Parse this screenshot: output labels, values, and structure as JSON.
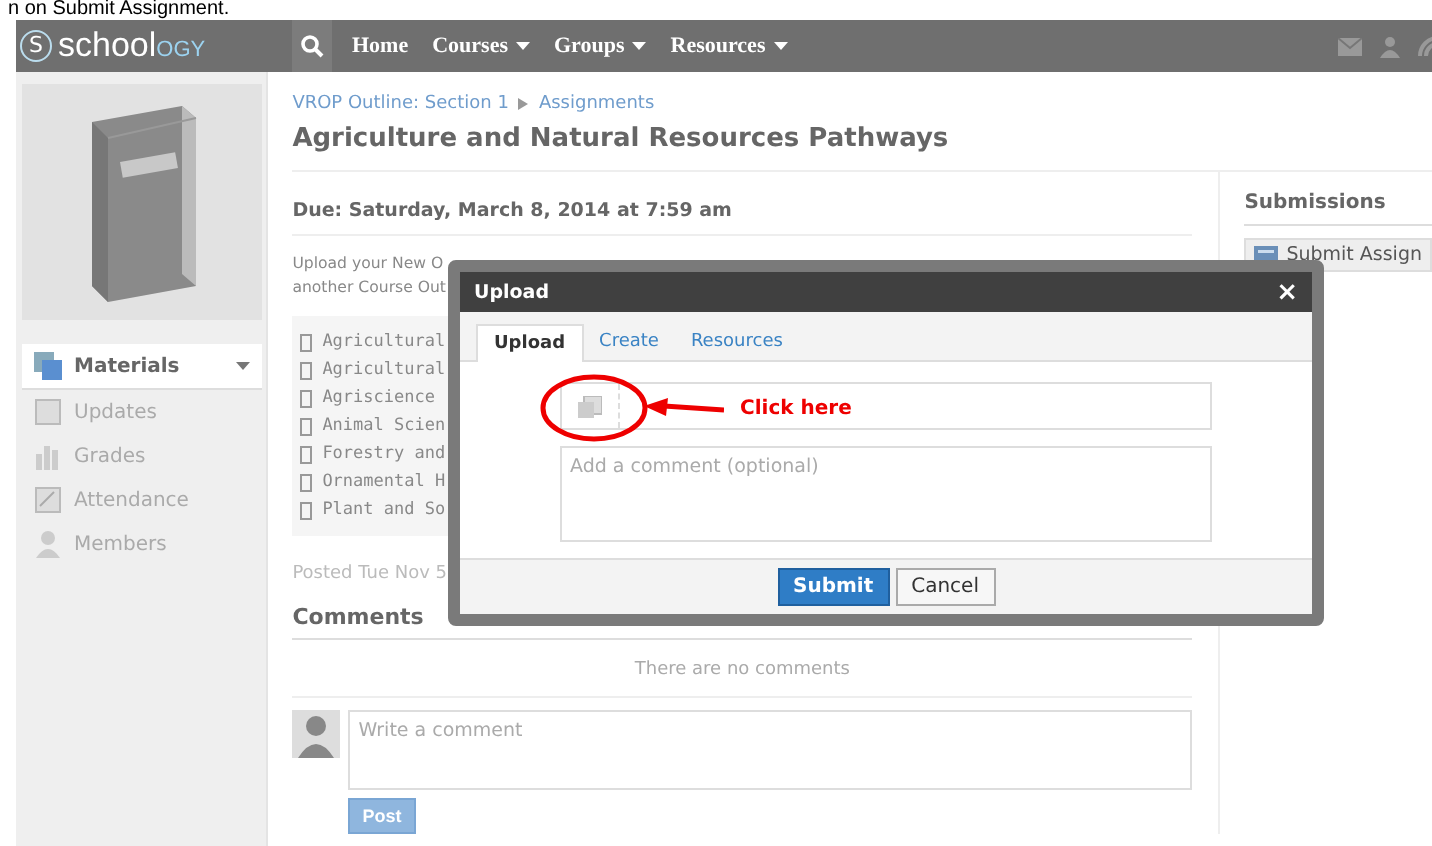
{
  "caption": "n on Submit Assignment.",
  "header": {
    "logo_mark": "S",
    "logo": [
      "school",
      "OGY"
    ],
    "nav": [
      {
        "label": "Home",
        "dropdown": false
      },
      {
        "label": "Courses",
        "dropdown": true
      },
      {
        "label": "Groups",
        "dropdown": true
      },
      {
        "label": "Resources",
        "dropdown": true
      }
    ]
  },
  "sidebar": {
    "items": [
      {
        "label": "Materials",
        "selected": true
      },
      {
        "label": "Updates",
        "selected": false
      },
      {
        "label": "Grades",
        "selected": false
      },
      {
        "label": "Attendance",
        "selected": false
      },
      {
        "label": "Members",
        "selected": false
      }
    ]
  },
  "breadcrumb": [
    "VROP Outline: Section 1",
    "Assignments"
  ],
  "title": "Agriculture and Natural Resources Pathways",
  "due": "Due: Saturday, March 8, 2014 at 7:59 am",
  "description_lines": [
    "Upload your New O",
    "another Course Out"
  ],
  "list_items": [
    "Agricultural",
    "Agricultural",
    "Agriscience",
    "Animal Scien",
    "Forestry and",
    "Ornamental H",
    "Plant and So"
  ],
  "posted": "Posted Tue Nov 5",
  "comments": {
    "heading": "Comments",
    "empty": "There are no comments",
    "placeholder": "Write a comment",
    "post_button": "Post"
  },
  "submissions": {
    "heading": "Submissions",
    "button": "Submit Assign"
  },
  "dialog": {
    "title": "Upload",
    "close": "×",
    "tabs": [
      {
        "label": "Upload",
        "selected": true
      },
      {
        "label": "Create",
        "selected": false
      },
      {
        "label": "Resources",
        "selected": false
      }
    ],
    "comment_placeholder": "Add a comment (optional)",
    "annotation": "Click here",
    "buttons": [
      {
        "label": "Submit",
        "kind": "primary"
      },
      {
        "label": "Cancel",
        "kind": "secondary"
      }
    ]
  }
}
